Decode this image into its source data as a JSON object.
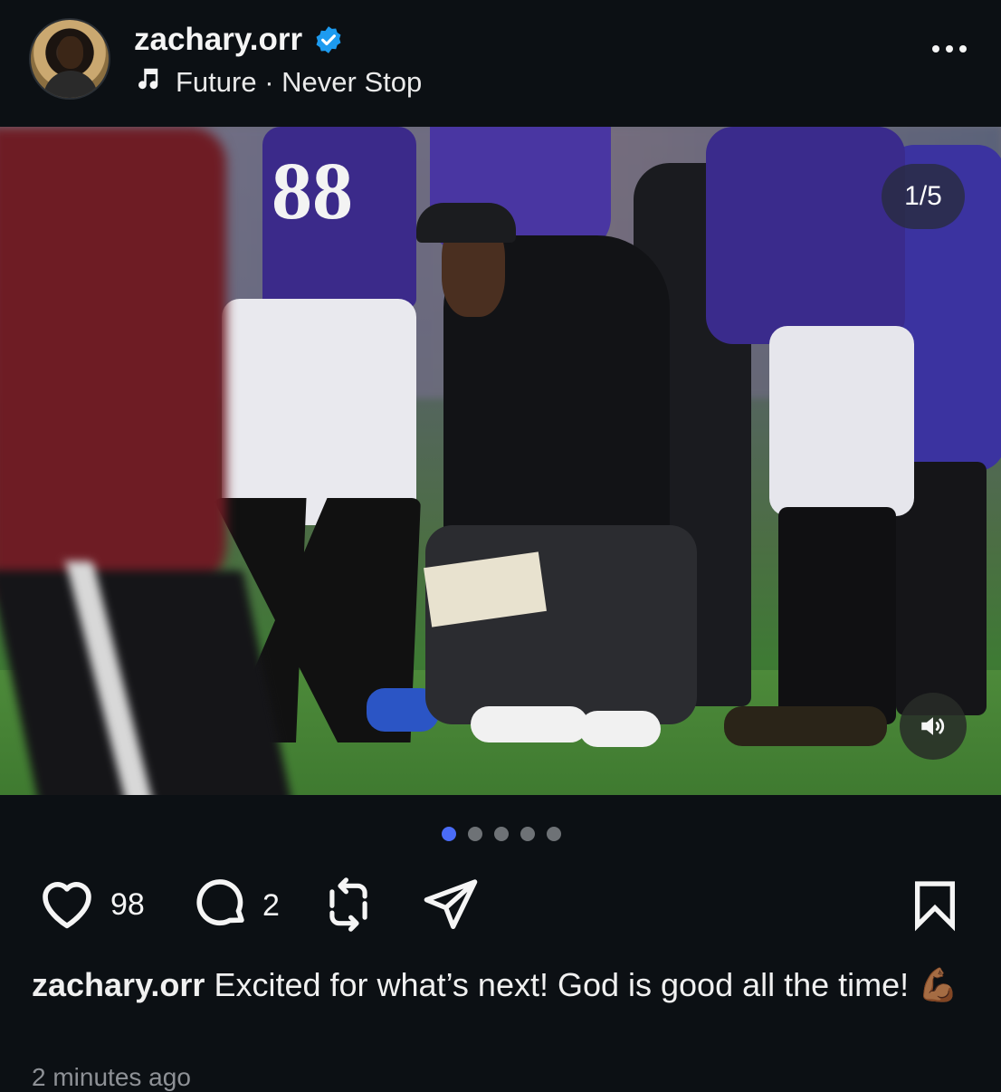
{
  "header": {
    "username": "zachary.orr",
    "verified": true,
    "audio": "Future · Never Stop",
    "icons": {
      "music": "music-note-icon",
      "more": "more-options-icon",
      "verified": "verified-badge-icon"
    }
  },
  "media": {
    "counter": "1/5",
    "jersey_number": "88",
    "page_count": 5,
    "active_page": 1,
    "sound_icon": "speaker-icon",
    "colors": {
      "active_dot": "#4a6cf7",
      "inactive_dot": "#6e7276"
    }
  },
  "actions": {
    "likes": "98",
    "comments": "2",
    "icons": [
      "heart-icon",
      "comment-icon",
      "repost-icon",
      "share-icon",
      "bookmark-icon"
    ]
  },
  "caption": {
    "username": "zachary.orr",
    "text": "Excited for what’s next! God is good all the time! 💪🏾"
  },
  "timestamp": "2 minutes ago",
  "colors": {
    "background": "#0c1014",
    "text": "#f5f5f5",
    "verified": "#1d9bf0"
  }
}
